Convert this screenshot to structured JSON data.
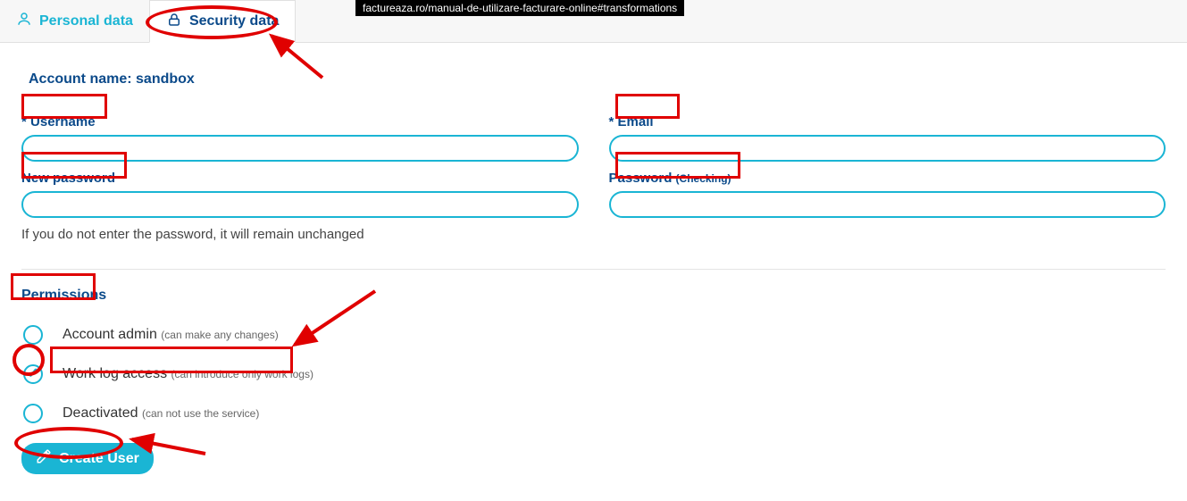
{
  "url": "factureaza.ro/manual-de-utilizare-facturare-online#transformations",
  "tabs": {
    "personal": "Personal data",
    "security": "Security data"
  },
  "account_name_prefix": "Account name: ",
  "account_name": "sandbox",
  "fields": {
    "username_label": "Username",
    "email_label": "Email",
    "new_password_label": "New password",
    "password_check_label": "Password",
    "password_check_note": "(Checking)",
    "username_value": "",
    "email_value": "",
    "new_password_value": "",
    "password_check_value": ""
  },
  "password_hint": "If you do not enter the password, it will remain unchanged",
  "permissions": {
    "heading": "Permissions",
    "options": [
      {
        "label": "Account admin",
        "note": "(can make any changes)",
        "selected": false
      },
      {
        "label": "Work log access",
        "note": "(can introduce only work logs)",
        "selected": true
      },
      {
        "label": "Deactivated",
        "note": "(can not use the service)",
        "selected": false
      }
    ]
  },
  "create_button": "Create User"
}
